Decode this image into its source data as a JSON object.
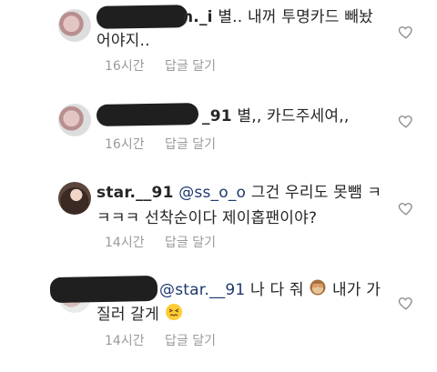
{
  "comments": [
    {
      "username_visible": "n._i",
      "text_line1": "별.. 내꺼 투명카드 빼놨",
      "text_line2": "어야지..",
      "time": "16시간",
      "reply_label": "답글 달기"
    },
    {
      "username_visible": "_91",
      "text": "별,, 카드주세여,,",
      "time": "16시간",
      "reply_label": "답글 달기"
    },
    {
      "username": "star.__91",
      "mention": "@ss_o_o",
      "text_line1": "그건 우리도 못뺌 ㅋ",
      "text_line2": "ㅋㅋㅋ 선착순이다 제이홉팬이야?",
      "time": "14시간",
      "reply_label": "답글 달기"
    },
    {
      "mention": "@star.__91",
      "text_line1": "나 다 줘",
      "text_line1b": "내가 가",
      "text_line2": "질러 갈게",
      "time": "14시간",
      "reply_label": "답글 달기"
    }
  ]
}
